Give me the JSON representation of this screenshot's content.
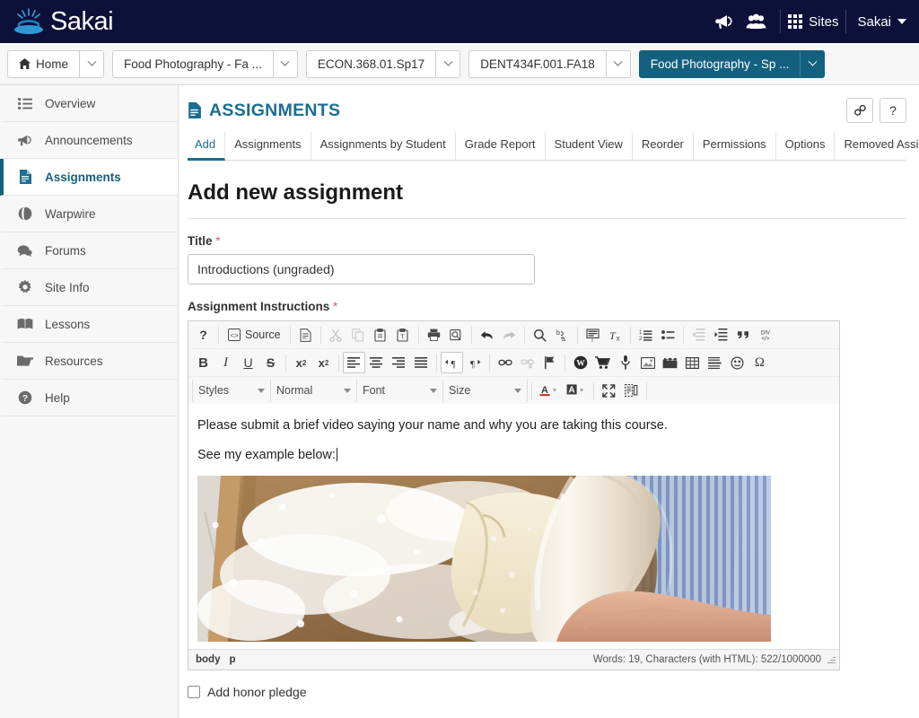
{
  "topbar": {
    "logo_text": "Sakai",
    "logo_icon": "sakai-ripple-logo",
    "announcements_icon": "megaphone-icon",
    "users_icon": "users-group-icon",
    "sites_icon": "grid-apps-icon",
    "sites_label": "Sites",
    "user_label": "Sakai",
    "user_caret_icon": "caret-down-icon"
  },
  "site_tabs": [
    {
      "label": "Home",
      "icon": "home-icon",
      "active": false
    },
    {
      "label": "Food Photography - Fa ...",
      "icon": "",
      "active": false
    },
    {
      "label": "ECON.368.01.Sp17",
      "icon": "",
      "active": false
    },
    {
      "label": "DENT434F.001.FA18",
      "icon": "",
      "active": false
    },
    {
      "label": "Food Photography - Sp ...",
      "icon": "",
      "active": true
    }
  ],
  "sidebar": {
    "items": [
      {
        "label": "Overview",
        "icon": "list-icon",
        "active": false
      },
      {
        "label": "Announcements",
        "icon": "megaphone-icon",
        "active": false
      },
      {
        "label": "Assignments",
        "icon": "document-icon",
        "active": true
      },
      {
        "label": "Warpwire",
        "icon": "globe-icon",
        "active": false
      },
      {
        "label": "Forums",
        "icon": "chat-bubble-icon",
        "active": false
      },
      {
        "label": "Site Info",
        "icon": "gear-icon",
        "active": false
      },
      {
        "label": "Lessons",
        "icon": "book-icon",
        "active": false
      },
      {
        "label": "Resources",
        "icon": "folder-icon",
        "active": false
      },
      {
        "label": "Help",
        "icon": "question-circle-icon",
        "active": false
      }
    ]
  },
  "tool": {
    "title": "ASSIGNMENTS",
    "title_icon": "document-icon",
    "link_button_icon": "link-chain-icon",
    "help_button_label": "?",
    "tabs": [
      {
        "label": "Add",
        "active": true
      },
      {
        "label": "Assignments",
        "active": false
      },
      {
        "label": "Assignments by Student",
        "active": false
      },
      {
        "label": "Grade Report",
        "active": false
      },
      {
        "label": "Student View",
        "active": false
      },
      {
        "label": "Reorder",
        "active": false
      },
      {
        "label": "Permissions",
        "active": false
      },
      {
        "label": "Options",
        "active": false
      },
      {
        "label": "Removed Assignments",
        "active": false
      }
    ]
  },
  "form": {
    "heading": "Add new assignment",
    "title_label": "Title",
    "required_mark": "*",
    "title_value": "Introductions (ungraded)",
    "title_placeholder": "",
    "instructions_label": "Assignment Instructions",
    "honor_pledge_label": "Add honor pledge",
    "honor_pledge_checked": false
  },
  "editor": {
    "toolbar_row1": [
      {
        "name": "help-icon",
        "label": "?",
        "state": "normal"
      },
      {
        "name": "source-button",
        "label": "Source",
        "state": "normal"
      },
      {
        "name": "new-page-icon",
        "label": "",
        "state": "normal"
      },
      {
        "name": "cut-icon",
        "label": "",
        "state": "disabled"
      },
      {
        "name": "copy-icon",
        "label": "",
        "state": "disabled"
      },
      {
        "name": "paste-icon",
        "label": "",
        "state": "normal"
      },
      {
        "name": "paste-as-text-icon",
        "label": "",
        "state": "normal"
      },
      {
        "name": "print-icon",
        "label": "",
        "state": "normal"
      },
      {
        "name": "preview-icon",
        "label": "",
        "state": "normal"
      },
      {
        "name": "undo-icon",
        "label": "",
        "state": "normal"
      },
      {
        "name": "redo-icon",
        "label": "",
        "state": "disabled"
      },
      {
        "name": "find-icon",
        "label": "",
        "state": "normal"
      },
      {
        "name": "replace-icon",
        "label": "",
        "state": "normal"
      },
      {
        "name": "select-all-icon",
        "label": "",
        "state": "normal"
      },
      {
        "name": "remove-format-icon",
        "label": "",
        "state": "normal"
      },
      {
        "name": "numbered-list-icon",
        "label": "",
        "state": "normal"
      },
      {
        "name": "bulleted-list-icon",
        "label": "",
        "state": "normal"
      },
      {
        "name": "decrease-indent-icon",
        "label": "",
        "state": "disabled"
      },
      {
        "name": "increase-indent-icon",
        "label": "",
        "state": "normal"
      },
      {
        "name": "blockquote-icon",
        "label": "",
        "state": "normal"
      },
      {
        "name": "div-container-icon",
        "label": "",
        "state": "normal"
      }
    ],
    "toolbar_row2": [
      {
        "name": "bold-icon",
        "label": "B",
        "state": "normal"
      },
      {
        "name": "italic-icon",
        "label": "I",
        "state": "normal"
      },
      {
        "name": "underline-icon",
        "label": "U",
        "state": "normal"
      },
      {
        "name": "strikethrough-icon",
        "label": "S",
        "state": "normal"
      },
      {
        "name": "subscript-icon",
        "label": "x",
        "state": "normal"
      },
      {
        "name": "superscript-icon",
        "label": "x",
        "state": "normal"
      },
      {
        "name": "align-left-icon",
        "label": "",
        "state": "active"
      },
      {
        "name": "align-center-icon",
        "label": "",
        "state": "normal"
      },
      {
        "name": "align-right-icon",
        "label": "",
        "state": "normal"
      },
      {
        "name": "align-justify-icon",
        "label": "",
        "state": "normal"
      },
      {
        "name": "text-direction-ltr-icon",
        "label": "",
        "state": "active"
      },
      {
        "name": "text-direction-rtl-icon",
        "label": "",
        "state": "normal"
      },
      {
        "name": "link-icon",
        "label": "",
        "state": "normal"
      },
      {
        "name": "unlink-icon",
        "label": "",
        "state": "disabled"
      },
      {
        "name": "anchor-flag-icon",
        "label": "",
        "state": "normal"
      },
      {
        "name": "warpwire-icon",
        "label": "W",
        "state": "normal"
      },
      {
        "name": "cart-icon",
        "label": "",
        "state": "normal"
      },
      {
        "name": "microphone-icon",
        "label": "",
        "state": "normal"
      },
      {
        "name": "image-icon",
        "label": "",
        "state": "normal"
      },
      {
        "name": "movie-clapper-icon",
        "label": "",
        "state": "normal"
      },
      {
        "name": "table-icon",
        "label": "",
        "state": "normal"
      },
      {
        "name": "horizontal-rule-icon",
        "label": "",
        "state": "normal"
      },
      {
        "name": "smiley-icon",
        "label": "",
        "state": "normal"
      },
      {
        "name": "special-character-icon",
        "label": "Ω",
        "state": "normal"
      }
    ],
    "dropdowns": [
      {
        "name": "styles-dropdown",
        "label": "Styles"
      },
      {
        "name": "format-dropdown",
        "label": "Normal"
      },
      {
        "name": "font-dropdown",
        "label": "Font"
      },
      {
        "name": "size-dropdown",
        "label": "Size"
      }
    ],
    "toolbar_row3_icons": [
      {
        "name": "text-color-icon",
        "label": "A",
        "state": "normal"
      },
      {
        "name": "background-color-icon",
        "label": "A",
        "state": "normal"
      },
      {
        "name": "maximize-icon",
        "label": "",
        "state": "normal"
      },
      {
        "name": "show-blocks-icon",
        "label": "",
        "state": "normal"
      }
    ],
    "content": {
      "paragraph1": "Please submit a brief video saying your name and why you are taking this course.",
      "paragraph2": "See my example below:",
      "embedded_media": "video-thumbnail-rolling-dough"
    },
    "status": {
      "path_element1": "body",
      "path_element2": "p",
      "counts": "Words: 19, Characters (with HTML): 522/1000000",
      "resize_grip_icon": "resize-grip-icon"
    }
  },
  "colors": {
    "topbar_bg": "#0d1039",
    "active_tab": "#14607f",
    "accent": "#1a6e92",
    "required": "#c0626b"
  }
}
